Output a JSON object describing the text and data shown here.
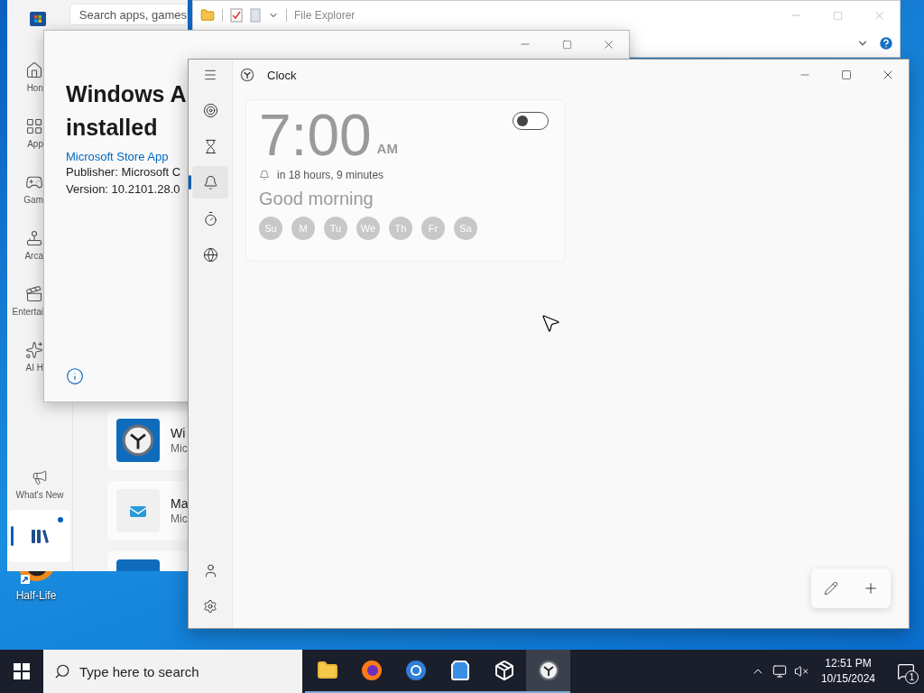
{
  "desktop": {
    "icons": [
      {
        "label": "Half-Life"
      }
    ]
  },
  "store": {
    "search": {
      "placeholder": "Search apps, games"
    },
    "nav": [
      {
        "label": "Hon",
        "selected": false
      },
      {
        "label": "App",
        "selected": false
      },
      {
        "label": "Gam",
        "selected": false
      },
      {
        "label": "Arca",
        "selected": false
      },
      {
        "label": "Entertai",
        "selected": false
      },
      {
        "label": "AI H",
        "selected": false
      }
    ],
    "footer_nav": [
      {
        "label": "What's New",
        "selected": false,
        "badge": false
      },
      {
        "selected": true,
        "badge": true
      }
    ],
    "apps": [
      {
        "name": "Wi",
        "publisher": "Mic"
      },
      {
        "name": "Ma",
        "publisher": "Mic"
      }
    ]
  },
  "file_explorer": {
    "title": "File Explorer"
  },
  "dialog": {
    "heading_lines": [
      "Windows A",
      "installed"
    ],
    "link": "Microsoft Store App",
    "publisher": "Publisher: Microsoft C",
    "version": "Version: 10.2101.28.0"
  },
  "clock": {
    "window": {
      "title": "Clock"
    },
    "nav": [
      {
        "selected": false
      },
      {
        "selected": false
      },
      {
        "selected": true
      },
      {
        "selected": false
      },
      {
        "selected": false
      }
    ],
    "alarms": [
      {
        "time": "7:00",
        "period": "AM",
        "on": false,
        "countdown": "in 18 hours, 9 minutes",
        "name": "Good morning",
        "days": [
          "Su",
          "M",
          "Tu",
          "We",
          "Th",
          "Fr",
          "Sa"
        ]
      }
    ]
  },
  "taskbar": {
    "search": {
      "placeholder": "Type here to search"
    },
    "apps": [
      {
        "selected": false
      },
      {
        "selected": false
      },
      {
        "selected": false
      },
      {
        "selected": false
      },
      {
        "selected": false
      },
      {
        "selected": true
      }
    ],
    "time": "12:51 PM",
    "date": "10/15/2024",
    "notifications": "1"
  }
}
